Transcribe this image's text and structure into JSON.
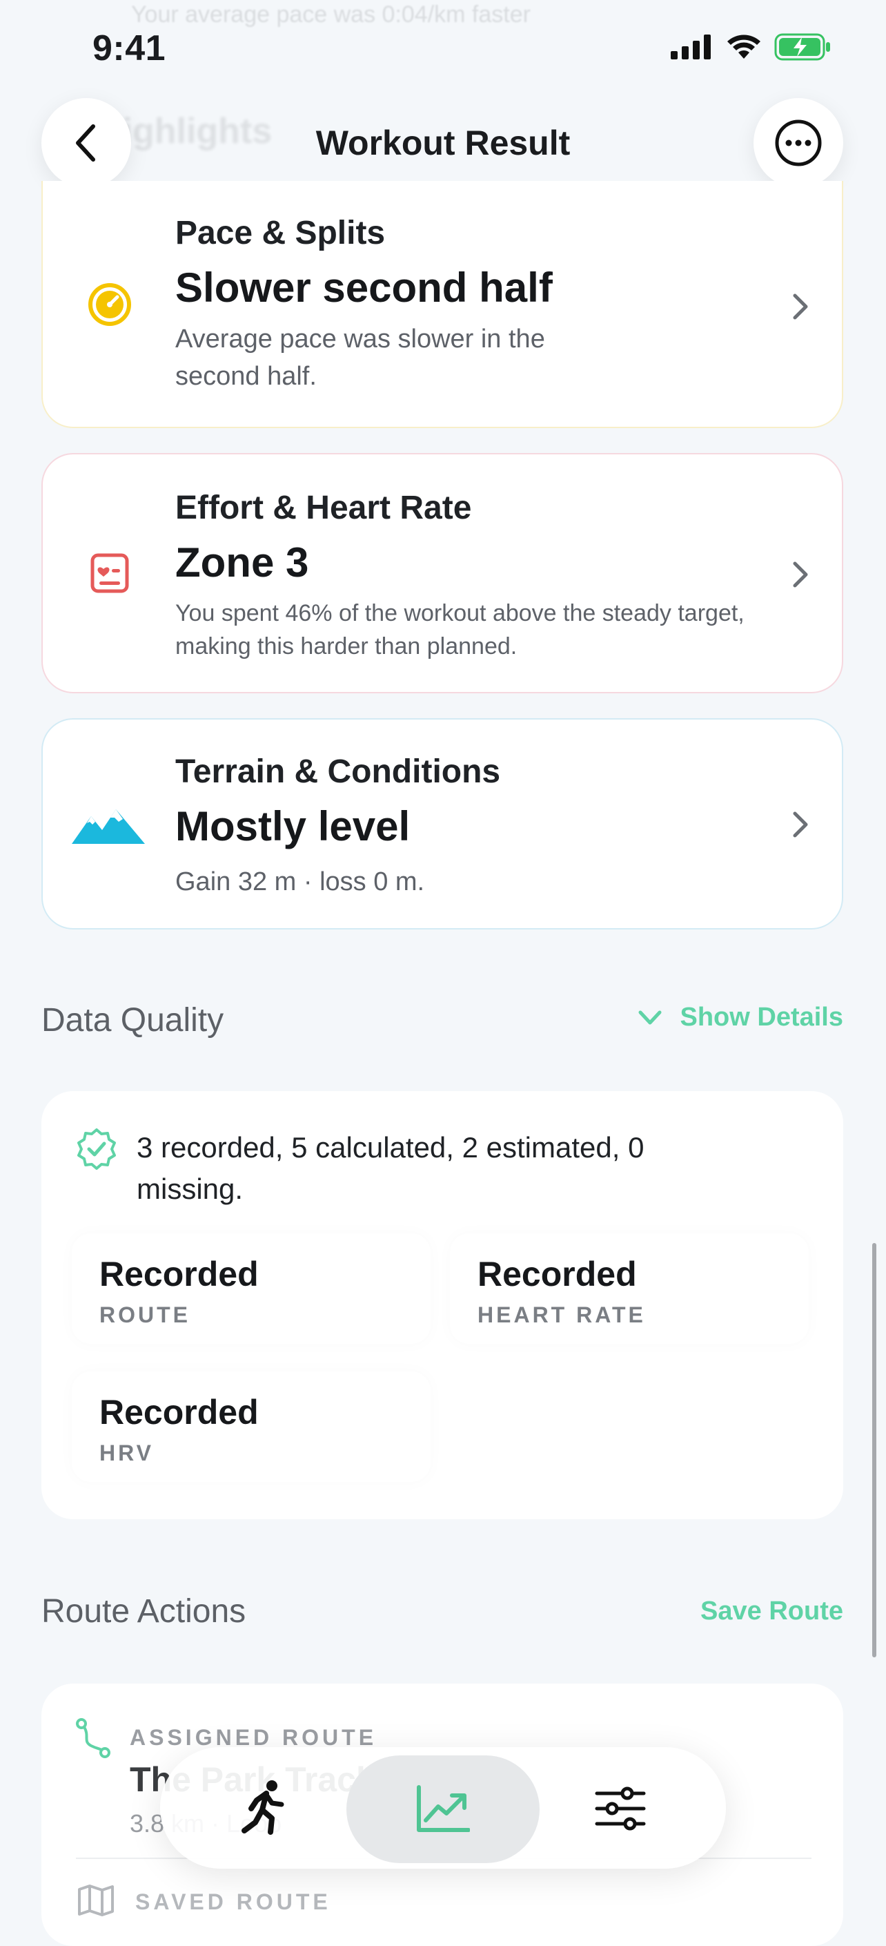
{
  "status_bar": {
    "time": "9:41"
  },
  "background": {
    "faded_text": "Your average pace was 0:04/km faster",
    "faded_heading": "Highlights"
  },
  "header": {
    "title": "Workout Result",
    "back_icon": "chevron-left-icon",
    "more_icon": "ellipsis-circle-icon"
  },
  "highlights": [
    {
      "category": "Pace & Splits",
      "headline": "Slower second half",
      "description": "Average pace was slower in the second half.",
      "icon": "speedometer-icon",
      "accent": "#f5c400"
    },
    {
      "category": "Effort & Heart Rate",
      "headline": "Zone 3",
      "description": "You spent 46% of the workout above the steady target, making this harder than planned.",
      "icon": "heart-card-icon",
      "accent": "#e55a59"
    },
    {
      "category": "Terrain & Conditions",
      "headline": "Mostly level",
      "description": "Gain 32 m · loss 0 m.",
      "icon": "mountains-icon",
      "accent": "#1bb8dd"
    }
  ],
  "data_quality": {
    "title": "Data Quality",
    "toggle_label": "Show Details",
    "summary": "3 recorded, 5 calculated, 2 estimated, 0 missing.",
    "items": [
      {
        "value": "Recorded",
        "label": "ROUTE"
      },
      {
        "value": "Recorded",
        "label": "HEART RATE"
      },
      {
        "value": "Recorded",
        "label": "HRV"
      }
    ]
  },
  "route_actions": {
    "title": "Route Actions",
    "action_label": "Save Route",
    "assigned_label": "ASSIGNED ROUTE",
    "assigned_name": "The Park Track",
    "assigned_meta": "3.8 km · Loop",
    "saved_label": "SAVED ROUTE"
  },
  "tabbar": {
    "tabs": [
      {
        "name": "workout",
        "icon": "runner-icon"
      },
      {
        "name": "analysis",
        "icon": "trend-chart-icon",
        "active": true
      },
      {
        "name": "settings",
        "icon": "sliders-icon"
      }
    ]
  },
  "colors": {
    "accent_green": "#5fd3a6",
    "background": "#f4f7fa",
    "text": "#1a1c1f"
  }
}
